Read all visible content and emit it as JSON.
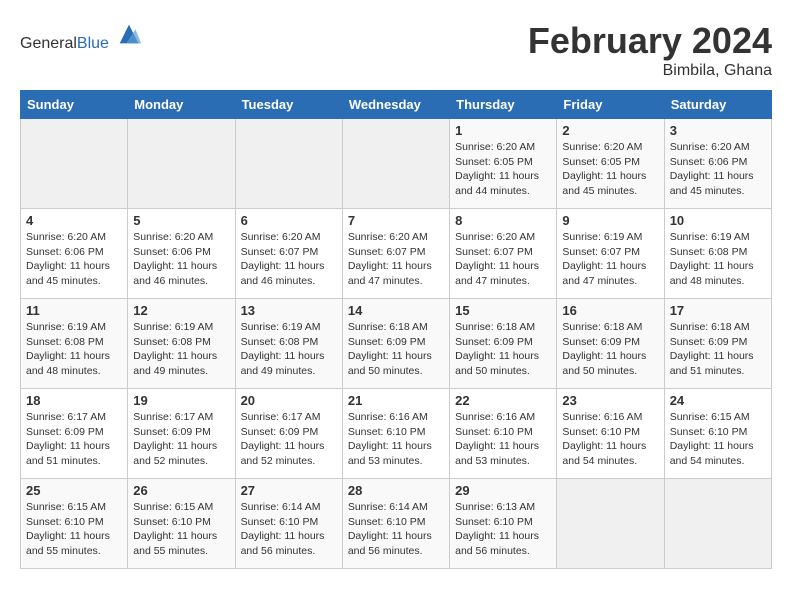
{
  "logo": {
    "general": "General",
    "blue": "Blue"
  },
  "header": {
    "month": "February 2024",
    "location": "Bimbila, Ghana"
  },
  "weekdays": [
    "Sunday",
    "Monday",
    "Tuesday",
    "Wednesday",
    "Thursday",
    "Friday",
    "Saturday"
  ],
  "weeks": [
    [
      {
        "day": "",
        "sunrise": "",
        "sunset": "",
        "daylight": ""
      },
      {
        "day": "",
        "sunrise": "",
        "sunset": "",
        "daylight": ""
      },
      {
        "day": "",
        "sunrise": "",
        "sunset": "",
        "daylight": ""
      },
      {
        "day": "",
        "sunrise": "",
        "sunset": "",
        "daylight": ""
      },
      {
        "day": "1",
        "sunrise": "Sunrise: 6:20 AM",
        "sunset": "Sunset: 6:05 PM",
        "daylight": "Daylight: 11 hours and 44 minutes."
      },
      {
        "day": "2",
        "sunrise": "Sunrise: 6:20 AM",
        "sunset": "Sunset: 6:05 PM",
        "daylight": "Daylight: 11 hours and 45 minutes."
      },
      {
        "day": "3",
        "sunrise": "Sunrise: 6:20 AM",
        "sunset": "Sunset: 6:06 PM",
        "daylight": "Daylight: 11 hours and 45 minutes."
      }
    ],
    [
      {
        "day": "4",
        "sunrise": "Sunrise: 6:20 AM",
        "sunset": "Sunset: 6:06 PM",
        "daylight": "Daylight: 11 hours and 45 minutes."
      },
      {
        "day": "5",
        "sunrise": "Sunrise: 6:20 AM",
        "sunset": "Sunset: 6:06 PM",
        "daylight": "Daylight: 11 hours and 46 minutes."
      },
      {
        "day": "6",
        "sunrise": "Sunrise: 6:20 AM",
        "sunset": "Sunset: 6:07 PM",
        "daylight": "Daylight: 11 hours and 46 minutes."
      },
      {
        "day": "7",
        "sunrise": "Sunrise: 6:20 AM",
        "sunset": "Sunset: 6:07 PM",
        "daylight": "Daylight: 11 hours and 47 minutes."
      },
      {
        "day": "8",
        "sunrise": "Sunrise: 6:20 AM",
        "sunset": "Sunset: 6:07 PM",
        "daylight": "Daylight: 11 hours and 47 minutes."
      },
      {
        "day": "9",
        "sunrise": "Sunrise: 6:19 AM",
        "sunset": "Sunset: 6:07 PM",
        "daylight": "Daylight: 11 hours and 47 minutes."
      },
      {
        "day": "10",
        "sunrise": "Sunrise: 6:19 AM",
        "sunset": "Sunset: 6:08 PM",
        "daylight": "Daylight: 11 hours and 48 minutes."
      }
    ],
    [
      {
        "day": "11",
        "sunrise": "Sunrise: 6:19 AM",
        "sunset": "Sunset: 6:08 PM",
        "daylight": "Daylight: 11 hours and 48 minutes."
      },
      {
        "day": "12",
        "sunrise": "Sunrise: 6:19 AM",
        "sunset": "Sunset: 6:08 PM",
        "daylight": "Daylight: 11 hours and 49 minutes."
      },
      {
        "day": "13",
        "sunrise": "Sunrise: 6:19 AM",
        "sunset": "Sunset: 6:08 PM",
        "daylight": "Daylight: 11 hours and 49 minutes."
      },
      {
        "day": "14",
        "sunrise": "Sunrise: 6:18 AM",
        "sunset": "Sunset: 6:09 PM",
        "daylight": "Daylight: 11 hours and 50 minutes."
      },
      {
        "day": "15",
        "sunrise": "Sunrise: 6:18 AM",
        "sunset": "Sunset: 6:09 PM",
        "daylight": "Daylight: 11 hours and 50 minutes."
      },
      {
        "day": "16",
        "sunrise": "Sunrise: 6:18 AM",
        "sunset": "Sunset: 6:09 PM",
        "daylight": "Daylight: 11 hours and 50 minutes."
      },
      {
        "day": "17",
        "sunrise": "Sunrise: 6:18 AM",
        "sunset": "Sunset: 6:09 PM",
        "daylight": "Daylight: 11 hours and 51 minutes."
      }
    ],
    [
      {
        "day": "18",
        "sunrise": "Sunrise: 6:17 AM",
        "sunset": "Sunset: 6:09 PM",
        "daylight": "Daylight: 11 hours and 51 minutes."
      },
      {
        "day": "19",
        "sunrise": "Sunrise: 6:17 AM",
        "sunset": "Sunset: 6:09 PM",
        "daylight": "Daylight: 11 hours and 52 minutes."
      },
      {
        "day": "20",
        "sunrise": "Sunrise: 6:17 AM",
        "sunset": "Sunset: 6:09 PM",
        "daylight": "Daylight: 11 hours and 52 minutes."
      },
      {
        "day": "21",
        "sunrise": "Sunrise: 6:16 AM",
        "sunset": "Sunset: 6:10 PM",
        "daylight": "Daylight: 11 hours and 53 minutes."
      },
      {
        "day": "22",
        "sunrise": "Sunrise: 6:16 AM",
        "sunset": "Sunset: 6:10 PM",
        "daylight": "Daylight: 11 hours and 53 minutes."
      },
      {
        "day": "23",
        "sunrise": "Sunrise: 6:16 AM",
        "sunset": "Sunset: 6:10 PM",
        "daylight": "Daylight: 11 hours and 54 minutes."
      },
      {
        "day": "24",
        "sunrise": "Sunrise: 6:15 AM",
        "sunset": "Sunset: 6:10 PM",
        "daylight": "Daylight: 11 hours and 54 minutes."
      }
    ],
    [
      {
        "day": "25",
        "sunrise": "Sunrise: 6:15 AM",
        "sunset": "Sunset: 6:10 PM",
        "daylight": "Daylight: 11 hours and 55 minutes."
      },
      {
        "day": "26",
        "sunrise": "Sunrise: 6:15 AM",
        "sunset": "Sunset: 6:10 PM",
        "daylight": "Daylight: 11 hours and 55 minutes."
      },
      {
        "day": "27",
        "sunrise": "Sunrise: 6:14 AM",
        "sunset": "Sunset: 6:10 PM",
        "daylight": "Daylight: 11 hours and 56 minutes."
      },
      {
        "day": "28",
        "sunrise": "Sunrise: 6:14 AM",
        "sunset": "Sunset: 6:10 PM",
        "daylight": "Daylight: 11 hours and 56 minutes."
      },
      {
        "day": "29",
        "sunrise": "Sunrise: 6:13 AM",
        "sunset": "Sunset: 6:10 PM",
        "daylight": "Daylight: 11 hours and 56 minutes."
      },
      {
        "day": "",
        "sunrise": "",
        "sunset": "",
        "daylight": ""
      },
      {
        "day": "",
        "sunrise": "",
        "sunset": "",
        "daylight": ""
      }
    ]
  ]
}
